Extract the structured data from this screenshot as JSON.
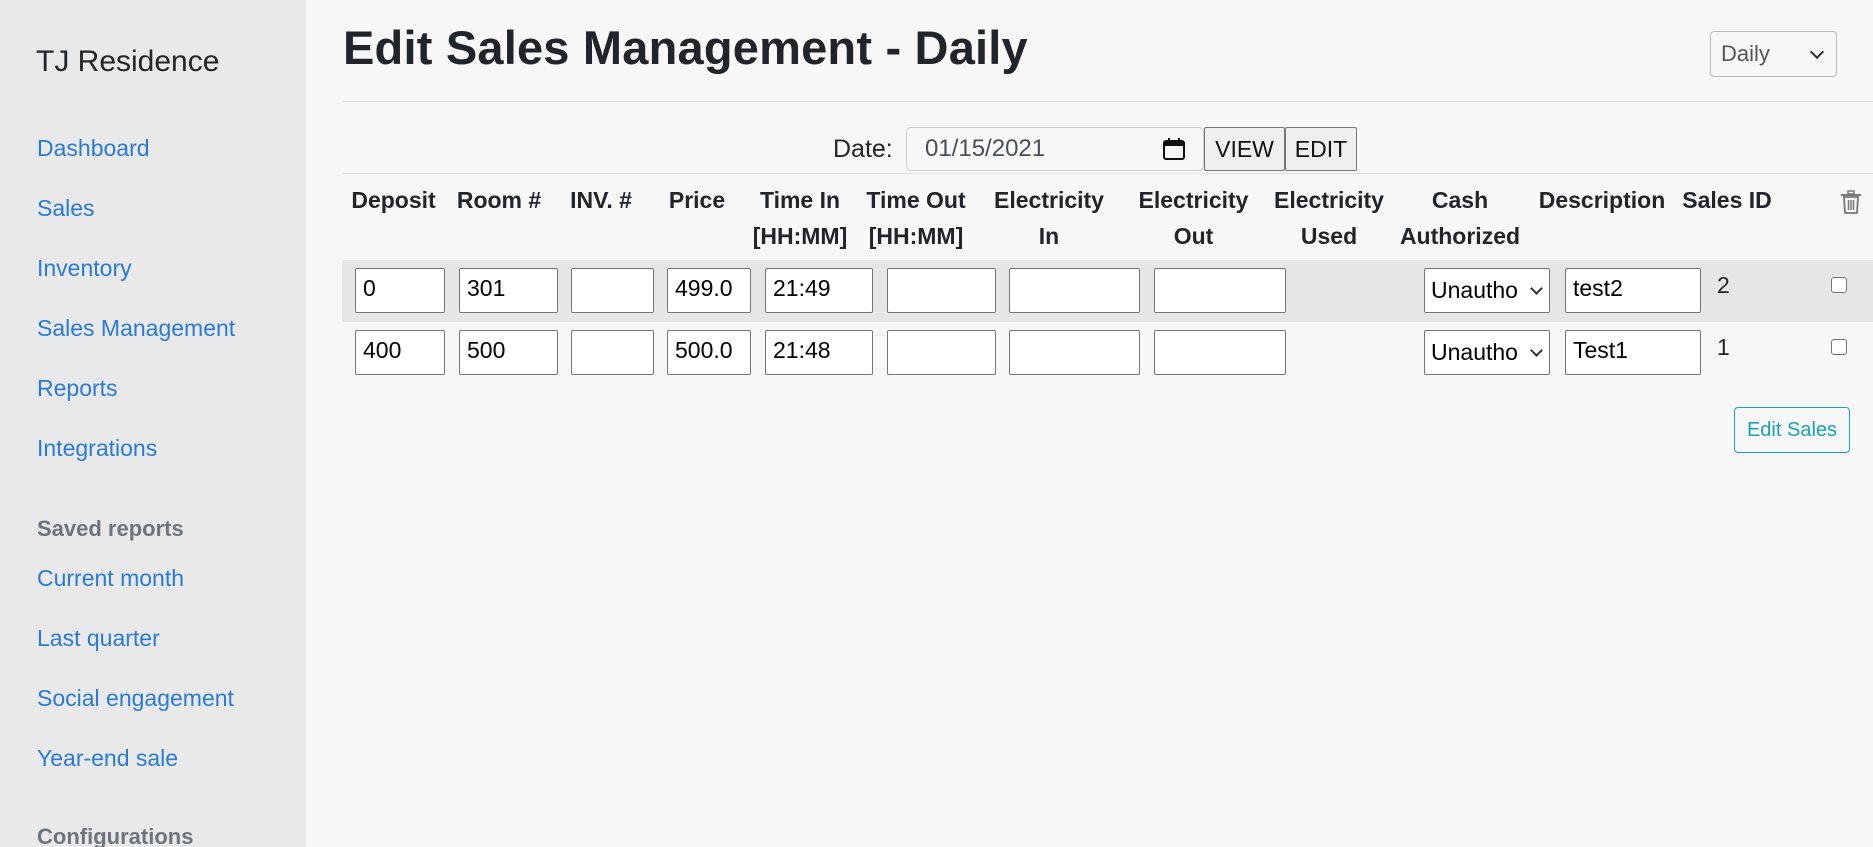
{
  "sidebar": {
    "brand": "TJ Residence",
    "nav": [
      "Dashboard",
      "Sales",
      "Inventory",
      "Sales Management",
      "Reports",
      "Integrations"
    ],
    "saved_reports_heading": "Saved reports",
    "saved_reports": [
      "Current month",
      "Last quarter",
      "Social engagement",
      "Year-end sale"
    ],
    "configurations_heading": "Configurations"
  },
  "header": {
    "title": "Edit Sales Management - Daily",
    "mode_select": "Daily"
  },
  "date_bar": {
    "label": "Date:",
    "value": "01/15/2021",
    "view_label": "VIEW",
    "edit_label": "EDIT"
  },
  "table": {
    "headers": {
      "deposit": "Deposit",
      "room": "Room #",
      "inv": "INV. #",
      "price": "Price",
      "time_in_1": "Time In",
      "time_in_2": "[HH:MM]",
      "time_out_1": "Time Out",
      "time_out_2": "[HH:MM]",
      "elec_in_1": "Electricity",
      "elec_in_2": "In",
      "elec_out_1": "Electricity",
      "elec_out_2": "Out",
      "elec_used_1": "Electricity",
      "elec_used_2": "Used",
      "cash_1": "Cash",
      "cash_2": "Authorized",
      "description": "Description",
      "sales_id": "Sales ID"
    },
    "rows": [
      {
        "deposit": "0",
        "room": "301",
        "inv": "",
        "price": "499.0",
        "time_in": "21:49",
        "time_out": "",
        "elec_in": "",
        "elec_out": "",
        "elec_used": "",
        "cash_authorized": "Unautho",
        "description": "test2",
        "sales_id": "2"
      },
      {
        "deposit": "400",
        "room": "500",
        "inv": "",
        "price": "500.0",
        "time_in": "21:48",
        "time_out": "",
        "elec_in": "",
        "elec_out": "",
        "elec_used": "",
        "cash_authorized": "Unautho",
        "description": "Test1",
        "sales_id": "1"
      }
    ]
  },
  "actions": {
    "edit_sales_label": "Edit Sales"
  },
  "icons": {
    "calendar": "calendar-icon",
    "trash": "trash-icon"
  },
  "colors": {
    "link": "#2a7ad8",
    "accent": "#17a2b8",
    "sidebar_bg": "#e9e9e9",
    "page_bg": "#f7f7f7",
    "stripe_bg": "#e6e6e6"
  }
}
